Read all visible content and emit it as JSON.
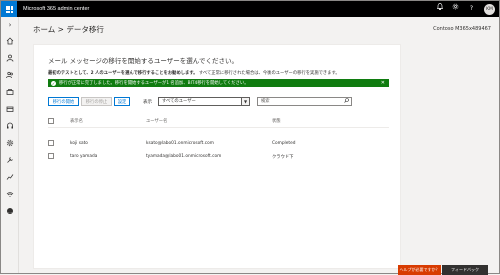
{
  "header": {
    "app_title": "Microsoft 365 admin center",
    "avatar_initials": "KM",
    "icons": [
      "bell-icon",
      "gear-icon",
      "help-icon"
    ]
  },
  "rail": {
    "icons": [
      "chevron-right-icon",
      "home-icon",
      "user-icon",
      "users-icon",
      "key-icon",
      "billing-icon",
      "headset-icon",
      "settings-icon",
      "wrench-icon",
      "chart-icon",
      "health-icon",
      "admin-centers-icon"
    ]
  },
  "page": {
    "title": "ホーム > データ移行",
    "tenant": "Contoso M365x489467"
  },
  "card": {
    "title": "メール メッセージの移行を開始するユーザーを選んでください。",
    "subtitle_bold": "最初のテストとして、2 人のユーザーを選んで移行することをお勧めします。",
    "subtitle_rest": " すべて正常に移行された場合は、今後のユーザーの移行を実施できます。",
    "banner_text": "移行が正常に完了しました。移行を開始するユーザーが1 名追加、BIT4移行を開始してください。",
    "buttons": {
      "start": "移行の開始",
      "stop": "移行の停止",
      "settings": "設定"
    },
    "view_label": "表示",
    "view_select": "すべてのユーザー",
    "search_placeholder": "検索"
  },
  "table": {
    "columns": [
      "表示名",
      "ユーザー名",
      "状態"
    ],
    "rows": [
      {
        "name": "koji sato",
        "user": "ksato@labo01.onmicrosoft.com",
        "status": "Completed"
      },
      {
        "name": "taro yamada",
        "user": "tyamada@labo01.onmicrosoft.com",
        "status": "クラウド下"
      }
    ]
  },
  "footer": {
    "help": "ヘルプが必要ですか？",
    "feedback": "フィードバック"
  },
  "colors": {
    "accent": "#0078d4",
    "success": "#107c10",
    "help": "#d83b01",
    "topbar": "#000000"
  }
}
